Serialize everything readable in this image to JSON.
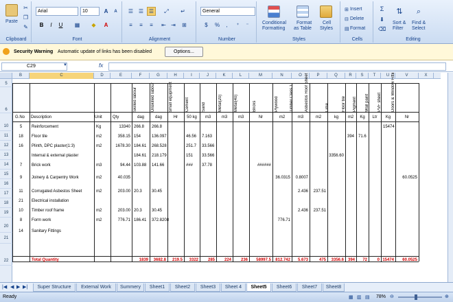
{
  "ribbon": {
    "clipboard": {
      "title": "Clipboard",
      "paste": "Paste"
    },
    "font": {
      "title": "Font",
      "name": "Arial",
      "size": "10"
    },
    "alignment": {
      "title": "Alignment"
    },
    "number": {
      "title": "Number",
      "format": "General",
      "currency": "$",
      "percent": "%",
      "comma": ","
    },
    "styles": {
      "title": "Styles",
      "conditional": "Conditional",
      "conditional2": "Formatting",
      "format_table": "Format",
      "format_table2": "as Table",
      "cell_styles": "Cell",
      "cell_styles2": "Styles"
    },
    "cells": {
      "title": "Cells",
      "insert": "Insert",
      "delete": "Delete",
      "format": "Format"
    },
    "editing": {
      "title": "Editing",
      "sort": "Sort &",
      "sort2": "Filter",
      "find": "Find &",
      "find2": "Select"
    }
  },
  "security": {
    "title": "Security Warning",
    "message": "Automatic update of links has been disabled",
    "options": "Options..."
  },
  "formula_bar": {
    "name_box": "C29",
    "fx": "fx",
    "formula": ""
  },
  "columns": [
    "B",
    "C",
    "D",
    "E",
    "F",
    "G",
    "H",
    "I",
    "J",
    "K",
    "L",
    "M",
    "N",
    "O",
    "P",
    "Q",
    "R",
    "S",
    "T",
    "U",
    "V",
    "X"
  ],
  "rows": [
    "5",
    "6",
    "10",
    "11",
    "12",
    "13",
    "14",
    "15",
    "16",
    "17",
    "18",
    "19",
    "20",
    "21",
    "22"
  ],
  "headers": {
    "gno": "G.No",
    "description": "Description",
    "unit": "Unit",
    "qty": "Qty",
    "skilled": "Skilled labour",
    "unskilled": "Unskilled labour",
    "small_equip": "small equipment",
    "cement": "Cement",
    "sand": "Sand",
    "metal20": "Metal(20)",
    "metal40": "Metal(40)",
    "bricks": "Bricks",
    "plywood": "Plywood",
    "timber": "Timber Class 1",
    "asbestos": "Asbestos Roof Sheet",
    "lime": "Lime",
    "floor_tile": "Floor tile",
    "pigment": "Pigment",
    "wall_paint": "Wall paint",
    "pvf_sheet": "PVF sheet",
    "doors": "Doors & Window Fittings"
  },
  "units": [
    "dag",
    "dag",
    "Hr",
    "50 kg",
    "m3",
    "m3",
    "m3",
    "Nr",
    "m2",
    "m3",
    "m2",
    "kg",
    "m2",
    "Kg",
    "Ltr",
    "Kg",
    "Nr"
  ],
  "table_rows": [
    {
      "gno": "5",
      "desc": "Reinforcement",
      "unit": "Kg",
      "qty": "13340",
      "f": "266.8",
      "g": "266.8",
      "u": "15474"
    },
    {
      "gno": "18",
      "desc": "Floor tile",
      "unit": "m2",
      "qty": "358.15",
      "f": "154",
      "g": "136.097",
      "i": "46.56",
      "j": "7.163",
      "r": "394",
      "s": "71.6"
    },
    {
      "gno": "16",
      "desc": "Plinth, DPC plaster(1:3)",
      "unit": "m2",
      "qty": "1678.30",
      "f": "184.61",
      "g": "268.528",
      "i": "251.7",
      "j": "33.566"
    },
    {
      "gno": "",
      "desc": "Internal & external plaster",
      "unit": "",
      "qty": "",
      "f": "184.61",
      "g": "218.179",
      "i": "151",
      "j": "33.566",
      "q": "3356.60"
    },
    {
      "gno": "7",
      "desc": "Brick work",
      "unit": "m3",
      "qty": "94.44",
      "f": "103.88",
      "g": "141.66",
      "i": "###",
      "j": "37.78",
      "m": "######"
    },
    {
      "gno": "9",
      "desc": "Joinery & Carpentry Work",
      "unit": "m2",
      "qty": "40.035",
      "n": "36.0315",
      "o": "0.8007",
      "v": "60.0525"
    },
    {
      "gno": "11",
      "desc": "Corrugated Asbestos Sheet",
      "unit": "m2",
      "qty": "203.00",
      "f": "20.3",
      "g": "30.45",
      "o": "2.436",
      "p": "237.51"
    },
    {
      "gno": "21",
      "desc": "Electrical installation",
      "unit": "",
      "qty": ""
    },
    {
      "gno": "10",
      "desc": "Timber roof frame",
      "unit": "m2",
      "qty": "203.00",
      "f": "20.3",
      "g": "30.45",
      "o": "2.436",
      "p": "237.51"
    },
    {
      "gno": "8",
      "desc": "Form work",
      "unit": "m2",
      "qty": "776.71",
      "f": "186.41",
      "g": "372.8208",
      "n": "776.71"
    },
    {
      "gno": "14",
      "desc": "Sanitary Fittings",
      "unit": "",
      "qty": ""
    }
  ],
  "total": {
    "label": "Total Quantity",
    "f": "1839",
    "g": "3682.8",
    "h": "219.5",
    "i": "3322",
    "j": "285",
    "k": "224",
    "l": "236",
    "m": "58997.5",
    "n": "812.742",
    "o": "5.673",
    "p": "475",
    "q": "3356.6",
    "r": "394",
    "s": "72",
    "t": "0",
    "u": "15474",
    "v": "60.0525"
  },
  "sheets": [
    "Super Structure",
    "External Work",
    "Summery",
    "Sheet1",
    "Sheet2",
    "Sheet3",
    "Sheet 4",
    "Sheet5",
    "Sheet6",
    "Sheet7",
    "Sheet8"
  ],
  "active_sheet": "Sheet5",
  "status": {
    "ready": "Ready",
    "zoom": "78%"
  }
}
